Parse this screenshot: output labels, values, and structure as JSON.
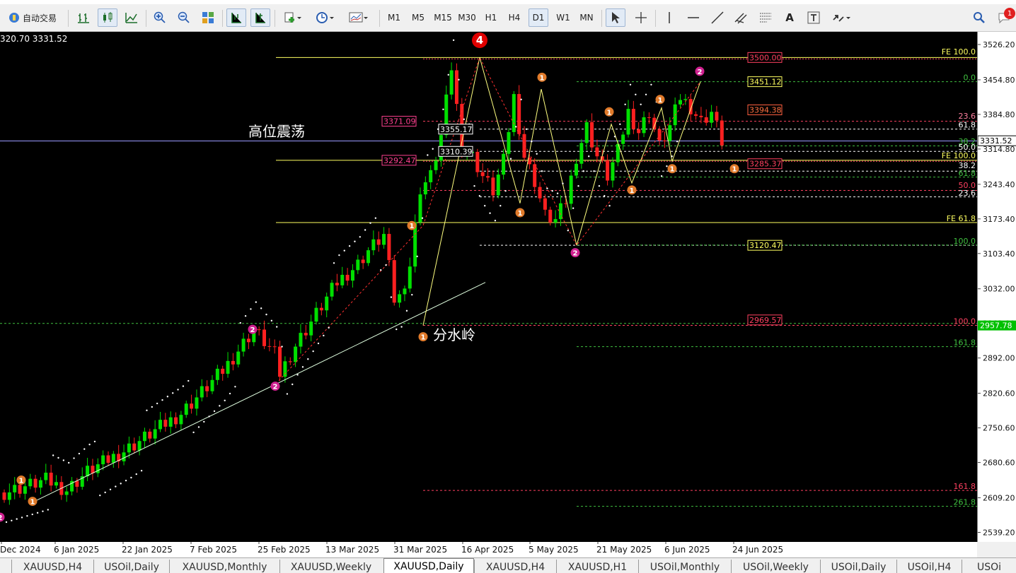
{
  "toolbar": {
    "autotrade_label": "自动交易",
    "timeframes": [
      "M1",
      "M5",
      "M15",
      "M30",
      "H1",
      "H4",
      "D1",
      "W1",
      "MN"
    ],
    "active_timeframe": "D1",
    "text_tool_label": "A",
    "notification_count": "1"
  },
  "chart": {
    "ohlc_header": "320.70 3331.52",
    "current_price": "3331.52",
    "marker_price": "2957.78",
    "annotations": {
      "high_range": "高位震荡",
      "watershed": "分水岭",
      "wave4": "4"
    },
    "price_ticks": [
      "3526.20",
      "3454.80",
      "3384.80",
      "3314.80",
      "3243.40",
      "3173.40",
      "3103.40",
      "3032.00",
      "2962.00",
      "2892.00",
      "2820.60",
      "2750.60",
      "2680.60",
      "2609.20",
      "2539.20"
    ],
    "date_ticks": [
      "Dec 2024",
      "6 Jan 2025",
      "22 Jan 2025",
      "7 Feb 2025",
      "25 Feb 2025",
      "13 Mar 2025",
      "31 Mar 2025",
      "16 Apr 2025",
      "5 May 2025",
      "21 May 2025",
      "6 Jun 2025",
      "24 Jun 2025"
    ],
    "price_boxes": [
      "3500.00",
      "3451.12",
      "3394.38",
      "3371.09",
      "3355.17",
      "3310.39",
      "3292.47",
      "3285.37",
      "3120.47",
      "2969.57"
    ],
    "fib_labels": [
      "FE 100.0",
      "0.0",
      "23.6",
      "61.8",
      "38.2",
      "50.0",
      "FE 100.0",
      "38.2",
      "61.8",
      "50.0",
      "23.6",
      "FE 61.8",
      "100.0",
      "100.0",
      "161.8",
      "161.8",
      "261.8"
    ]
  },
  "tabs": [
    "XAUUSD,H4",
    "USOil,Daily",
    "XAUUSD,Monthly",
    "XAUUSD,Weekly",
    "XAUUSD,Daily",
    "XAUUSD,H4",
    "XAUUSD,H1",
    "USOil,Monthly",
    "USOil,Weekly",
    "USOil,Daily",
    "USOil,H4",
    "USOi"
  ],
  "active_tab": "XAUUSD,Daily",
  "colors": {
    "bull": "#00e000",
    "bear": "#ff2020",
    "fib": "#ffff60",
    "background": "#000000"
  }
}
